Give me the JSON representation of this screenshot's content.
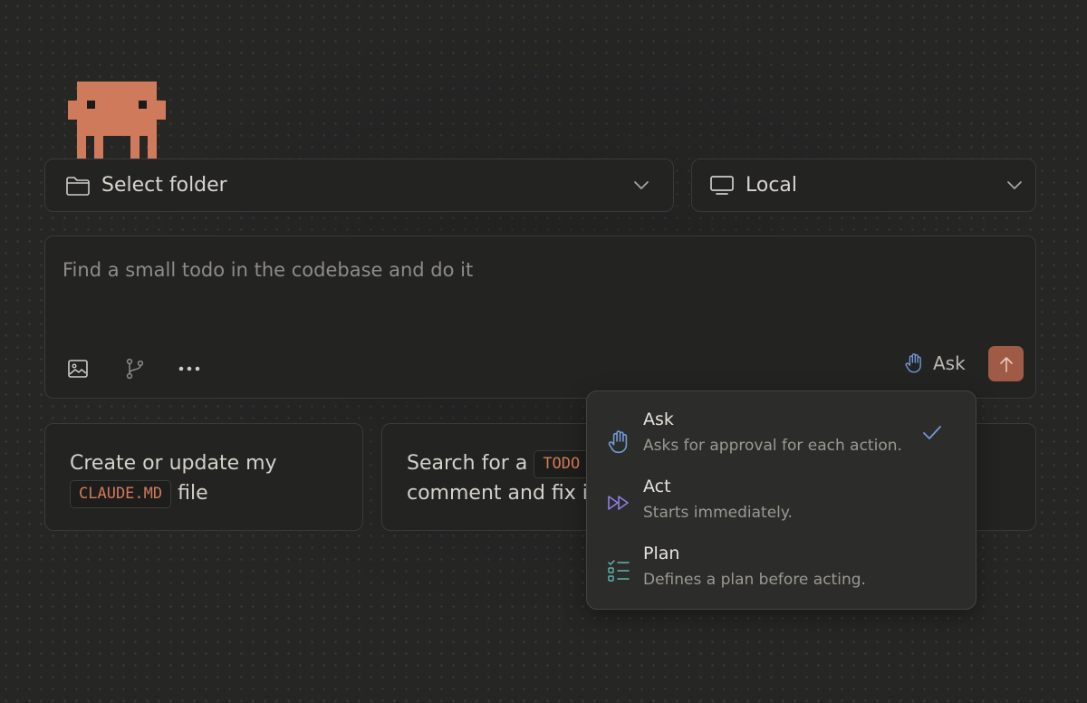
{
  "mascot": {
    "icon": "pixel-mascot-icon",
    "color": "#d07a5c"
  },
  "folder_select": {
    "label": "Select folder",
    "icon": "folder-icon"
  },
  "env_select": {
    "label": "Local",
    "icon": "monitor-icon"
  },
  "prompt": {
    "placeholder": "Find a small todo in the codebase and do it",
    "mode_label": "Ask",
    "tools": [
      "image-icon",
      "branch-icon",
      "more-icon"
    ],
    "send_color": "#9f5b45"
  },
  "cards": [
    {
      "before": "Create or update my",
      "code": "CLAUDE.MD",
      "after": "file"
    },
    {
      "before": "Search for a",
      "code": "TODO",
      "after": "comment and fix it"
    }
  ],
  "mode_menu": {
    "options": [
      {
        "title": "Ask",
        "desc": "Asks for approval for each action.",
        "icon": "hand-icon",
        "color": "#6f9ad6",
        "selected": true
      },
      {
        "title": "Act",
        "desc": "Starts immediately.",
        "icon": "fast-forward-icon",
        "color": "#8f7ee0",
        "selected": false
      },
      {
        "title": "Plan",
        "desc": "Defines a plan before acting.",
        "icon": "checklist-icon",
        "color": "#5fb5b0",
        "selected": false
      }
    ]
  }
}
